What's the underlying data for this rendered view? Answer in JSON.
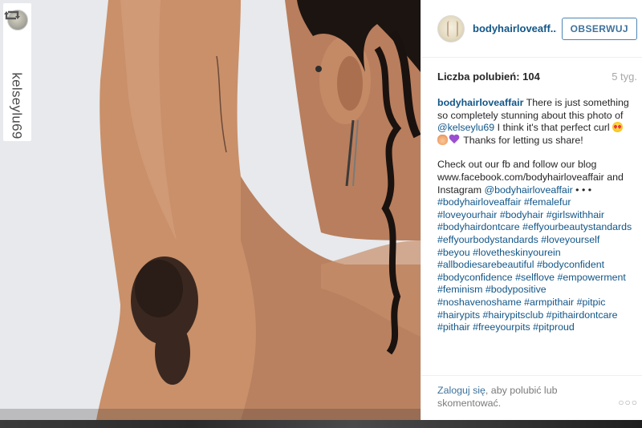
{
  "repost": {
    "username": "kelseylu69",
    "icon": "repost-icon"
  },
  "post": {
    "account": "bodyhairloveaff...",
    "follow_label": "OBSERWUJ",
    "likes": "Liczba polubień: 104",
    "time_ago": "5 tyg.",
    "caption": {
      "author": "bodyhairloveaffair",
      "text_1": " There is just something so completely stunning about this photo of ",
      "mention_1": "@kelseylu69",
      "text_2": " I think it's that perfect curl ",
      "text_3": " Thanks for letting us share!",
      "text_4": "Check out our fb and follow our blog www.facebook.com/bodyhairloveaffair and Instagram ",
      "mention_2": "@bodyhairloveaffair",
      "text_5": " • • • ",
      "hashtags": "#bodyhairloveaffair #femalefur #loveyourhair #bodyhair #girlswithhair #bodyhairdontcare #effyourbeautystandards #effyourbodystandards #loveyourself #beyou #lovetheskinyourein #allbodiesarebeautiful #bodyconfident #bodyconfidence #selflove #empowerment #feminism #bodypositive #noshavenoshame #armpithair #pitpic #hairypits #hairypitsclub #pithairdontcare #pithair #freeyourpits #pitproud"
    },
    "login": {
      "link": "Zaloguj się",
      "text": ", aby polubić lub skomentować."
    },
    "more_label": "○○○"
  },
  "colors": {
    "link": "#125688",
    "button_border": "#4e86b4",
    "muted": "#a5a7aa"
  }
}
